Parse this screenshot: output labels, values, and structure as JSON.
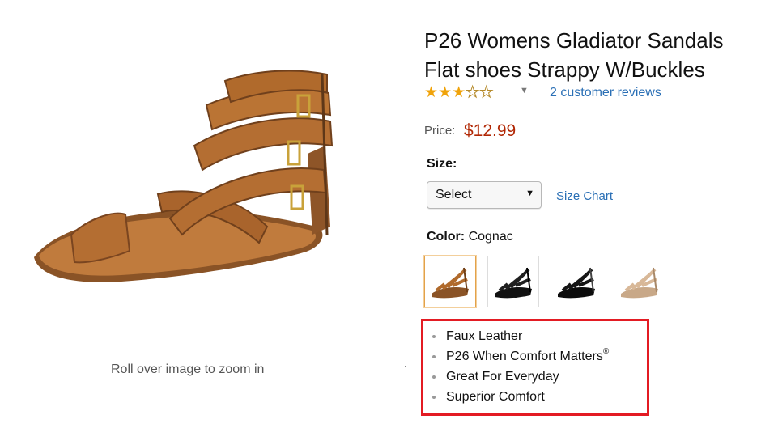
{
  "product": {
    "title_line1": "P26 Womens Gladiator Sandals",
    "title_line2": "Flat shoes Strappy W/Buckles",
    "rating": 3,
    "rating_max": 5,
    "review_link": "2 customer reviews",
    "price_label": "Price:",
    "price_value": "$12.99",
    "zoom_hint": "Roll over image to zoom in"
  },
  "size": {
    "label": "Size:",
    "select_value": "Select",
    "chart_link": "Size Chart"
  },
  "color": {
    "label": "Color:",
    "selected_value": "Cognac",
    "swatches": [
      {
        "name": "Cognac",
        "hex": "#b06a2c",
        "selected": true
      },
      {
        "name": "Black",
        "hex": "#1f1f1f",
        "selected": false
      },
      {
        "name": "Black Patent",
        "hex": "#151515",
        "selected": false
      },
      {
        "name": "Nude",
        "hex": "#d8b898",
        "selected": false
      }
    ]
  },
  "features": [
    {
      "text": "Faux Leather",
      "sup": ""
    },
    {
      "text": "P26 When Comfort Matters",
      "sup": "®"
    },
    {
      "text": "Great For Everyday",
      "sup": ""
    },
    {
      "text": "Superior Comfort",
      "sup": ""
    }
  ],
  "colors": {
    "price": "#b12704",
    "link": "#2a6fb5",
    "star": "#f0a30a",
    "highlight_box": "#e31b23",
    "leather": "#b46e32"
  },
  "icons": {
    "star_filled": "★",
    "star_empty": "☆",
    "caret": "▼"
  }
}
